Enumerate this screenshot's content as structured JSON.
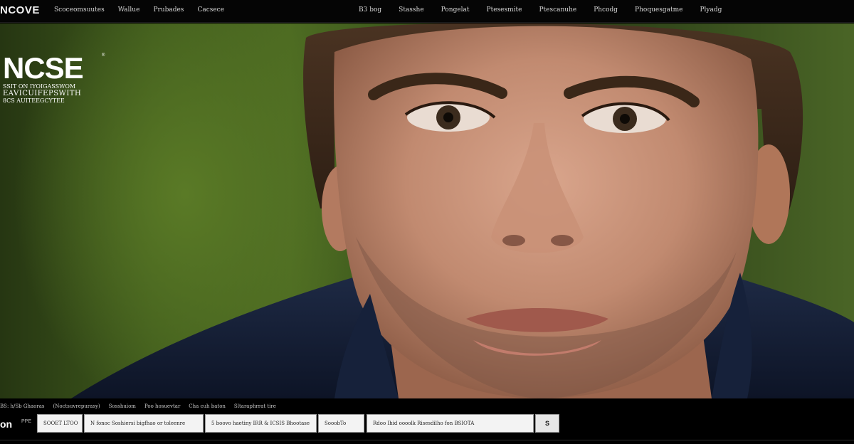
{
  "header": {
    "brand": "NCOVE",
    "nav_left": [
      "Scoceomsuutes",
      "Wallue",
      "Prubades",
      "Cacsece"
    ],
    "nav_right": [
      "B3 bog",
      "Stasshe",
      "Pongelat",
      "Ptesesmite",
      "Ptescanuhe",
      "Phcodg",
      "Phoquesgatme",
      "Plyadg"
    ]
  },
  "hero": {
    "logo": "NCSE",
    "logo_mark": "®",
    "tagline": [
      "SSIT ON IYOIGASSWOM",
      "EAVICUIFEPSWITH",
      "8CS AUITEEGCYTEE"
    ]
  },
  "footer": {
    "links": [
      "BS: h/Sb Ghaoras",
      "(Noctsuvrepurasy)",
      "Sosshuiom",
      "Poo hosuevtar",
      "Cha cuh baton",
      "Sltaraphrrat tire"
    ],
    "on_label": "on",
    "on_sub": "PPE",
    "fields": [
      "SOOET LTOO",
      "N fonoc Soshiersi bigfhao or toleenre",
      "5 boovo haetiny IRR & ICSIS Bhootase",
      "SooobTo",
      "Rdoo Ihid oooolk Risesdilho fon BSIOTA"
    ],
    "submit_label": "S"
  },
  "colors": {
    "background": "#000000",
    "hero_green": "#4d6b22",
    "nav_text": "#d8d8d8",
    "field_bg": "#f3f3f3"
  },
  "icons": {
    "submit": "search-icon"
  }
}
